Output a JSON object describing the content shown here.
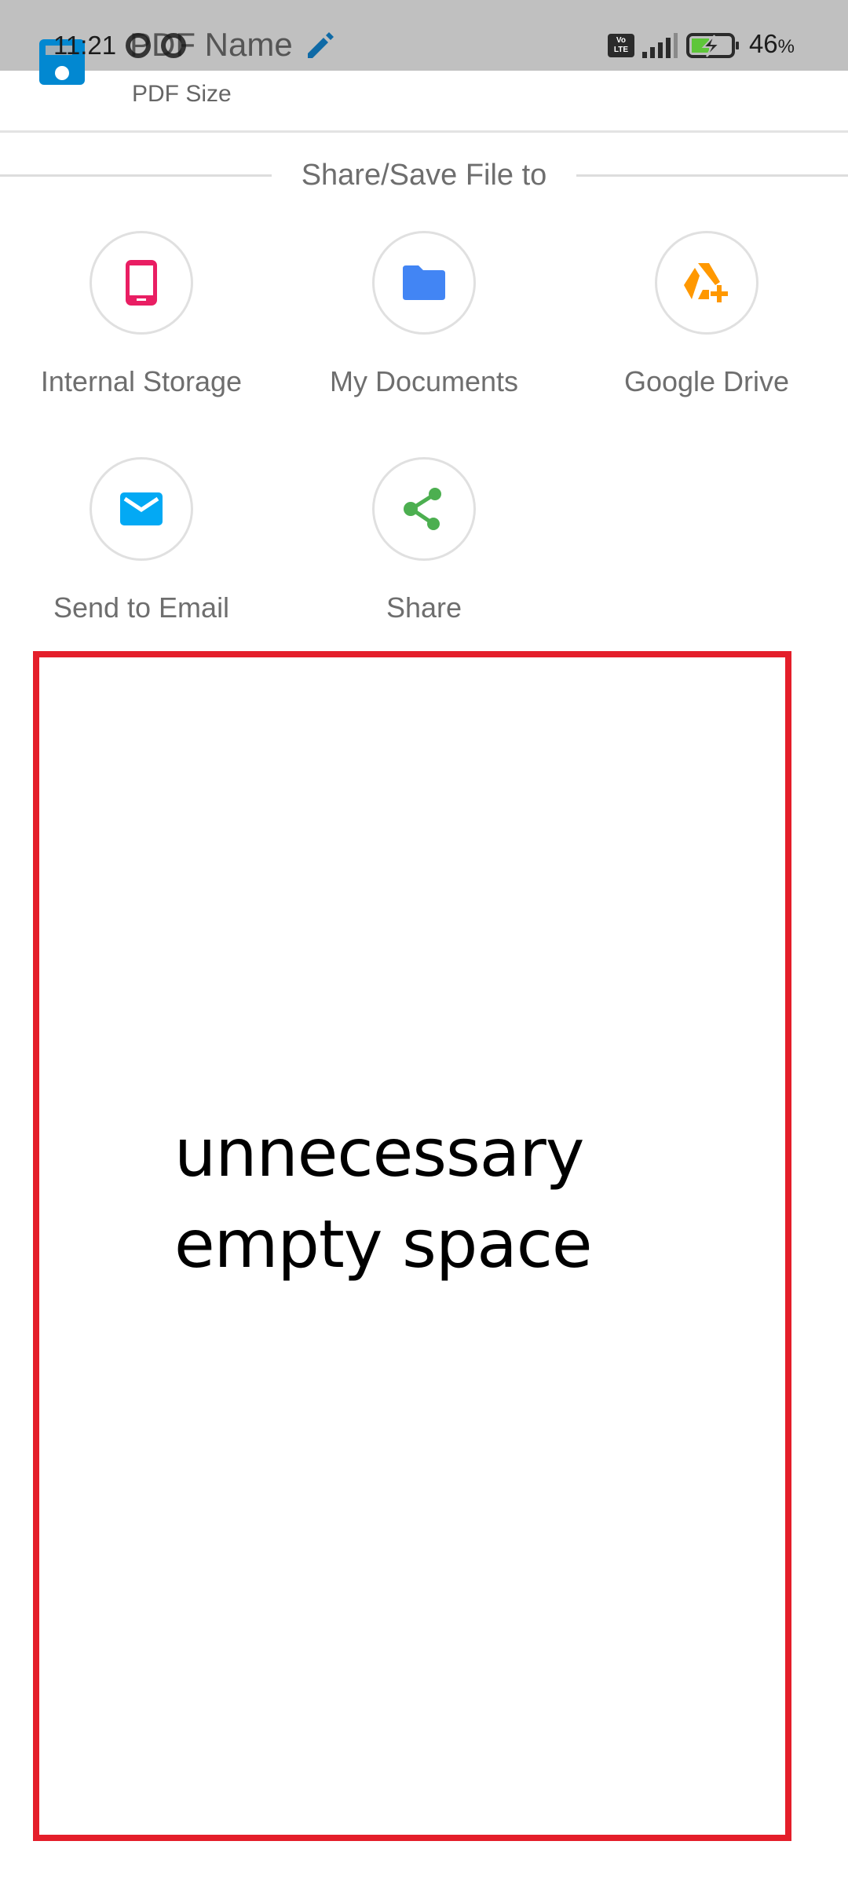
{
  "status_bar": {
    "time": "11:21",
    "network_badge": "VoLTE",
    "battery_percent": "46",
    "battery_unit": "%",
    "battery_charging": true,
    "signal_bars": "4/5"
  },
  "header": {
    "title": "PDF Name",
    "subtitle": "PDF Size",
    "file_icon": "save-icon",
    "edit_icon": "pencil-icon"
  },
  "section": {
    "title": "Share/Save File to"
  },
  "options": [
    {
      "label": "Internal Storage",
      "icon": "smartphone-icon",
      "color": "#e91e63"
    },
    {
      "label": "My Documents",
      "icon": "folder-icon",
      "color": "#4285f4"
    },
    {
      "label": "Google Drive",
      "icon": "google-drive-add-icon",
      "color": "#ff9800"
    },
    {
      "label": "Send to Email",
      "icon": "email-icon",
      "color": "#03a9f4"
    },
    {
      "label": "Share",
      "icon": "share-icon",
      "color": "#4caf50"
    }
  ],
  "annotation": {
    "line1": "unnecessary",
    "line2": "empty space",
    "box_color": "#e41e2a"
  },
  "colors": {
    "status_bar": "#c0c0c0",
    "accent": "#0288d1",
    "text_gray": "#6e6e6e"
  }
}
